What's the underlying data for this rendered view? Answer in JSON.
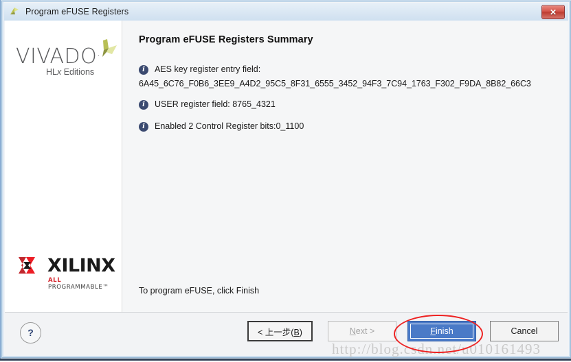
{
  "window": {
    "title": "Program eFUSE Registers",
    "app_icon": "vivado-triangle-icon",
    "close_label": "✕"
  },
  "sidebar": {
    "vivado": {
      "wordmark": "VIVADO",
      "registered_dot": ".",
      "subtitle_pre": "HL",
      "subtitle_italic": "x",
      "subtitle_post": " Editions",
      "mark_colors": [
        "#c9cf62",
        "#8c9440",
        "#e3e8a8"
      ]
    },
    "xilinx": {
      "wordmark": "XILINX",
      "tagline_accent": "ALL",
      "tagline_rest": " PROGRAMMABLE™",
      "mark_color": "#d6242c"
    }
  },
  "main": {
    "heading": "Program eFUSE Registers Summary",
    "info_items": [
      {
        "icon": "info-icon",
        "label": "AES key register entry field:"
      },
      {
        "icon": "info-icon",
        "label": "USER register field: 8765_4321"
      },
      {
        "icon": "info-icon",
        "label": "Enabled 2 Control Register bits:0_1100"
      }
    ],
    "aes_key_value": "6A45_6C76_F0B6_3EE9_A4D2_95C5_8F31_6555_3452_94F3_7C94_1763_F302_F9DA_8B82_66C3",
    "finish_hint": "To program eFUSE, click Finish"
  },
  "footer": {
    "help_label": "?",
    "buttons": {
      "back": {
        "prefix": "< 上一步(",
        "mnemonic": "B",
        "suffix": ")",
        "enabled": true
      },
      "next": {
        "mnemonic": "N",
        "text_after": "ext >",
        "enabled": false
      },
      "finish": {
        "mnemonic": "F",
        "text_after": "inish",
        "enabled": true,
        "default": true
      },
      "cancel": {
        "label": "Cancel",
        "enabled": true
      }
    }
  },
  "annotation": {
    "shape": "red-ellipse",
    "color": "#ee2222",
    "target": "finish-button"
  },
  "watermark": {
    "text": "http://blog.csdn.net/u010161493"
  }
}
